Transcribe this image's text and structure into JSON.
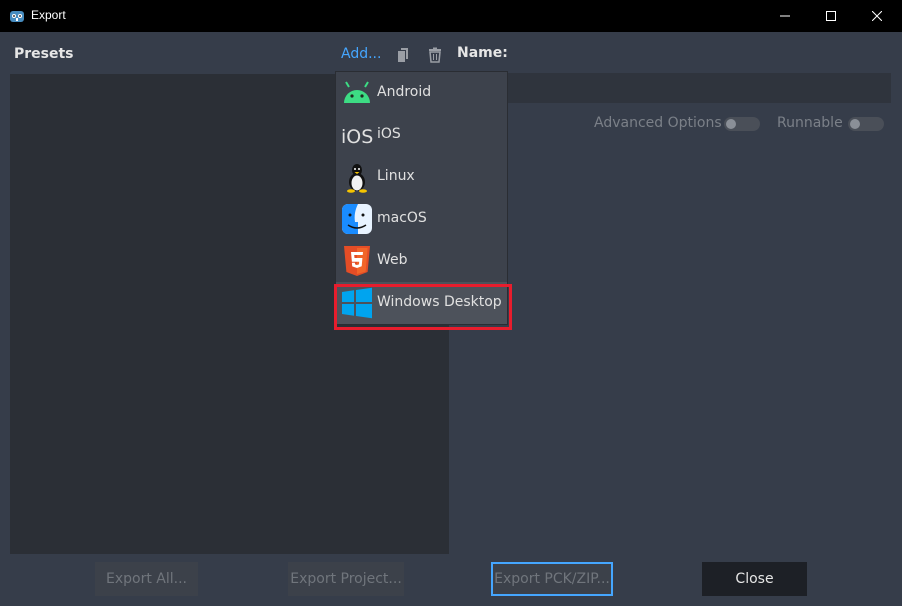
{
  "window": {
    "title": "Export"
  },
  "header": {
    "presets_label": "Presets",
    "add_label": "Add...",
    "name_label": "Name:"
  },
  "options": {
    "advanced_label": "Advanced Options",
    "runnable_label": "Runnable"
  },
  "platform_menu": {
    "items": [
      {
        "label": "Android",
        "icon": "android-icon"
      },
      {
        "label": "iOS",
        "icon": "ios-icon"
      },
      {
        "label": "Linux",
        "icon": "linux-icon"
      },
      {
        "label": "macOS",
        "icon": "macos-icon"
      },
      {
        "label": "Web",
        "icon": "html5-icon"
      },
      {
        "label": "Windows Desktop",
        "icon": "windows-icon"
      }
    ],
    "highlighted_item": "Windows Desktop",
    "highlight_color": "#e81d2d"
  },
  "footer": {
    "export_all": "Export All...",
    "export_project": "Export Project...",
    "export_pck": "Export PCK/ZIP...",
    "close": "Close"
  },
  "colors": {
    "accent": "#45a6ff",
    "background": "#363d4a"
  }
}
